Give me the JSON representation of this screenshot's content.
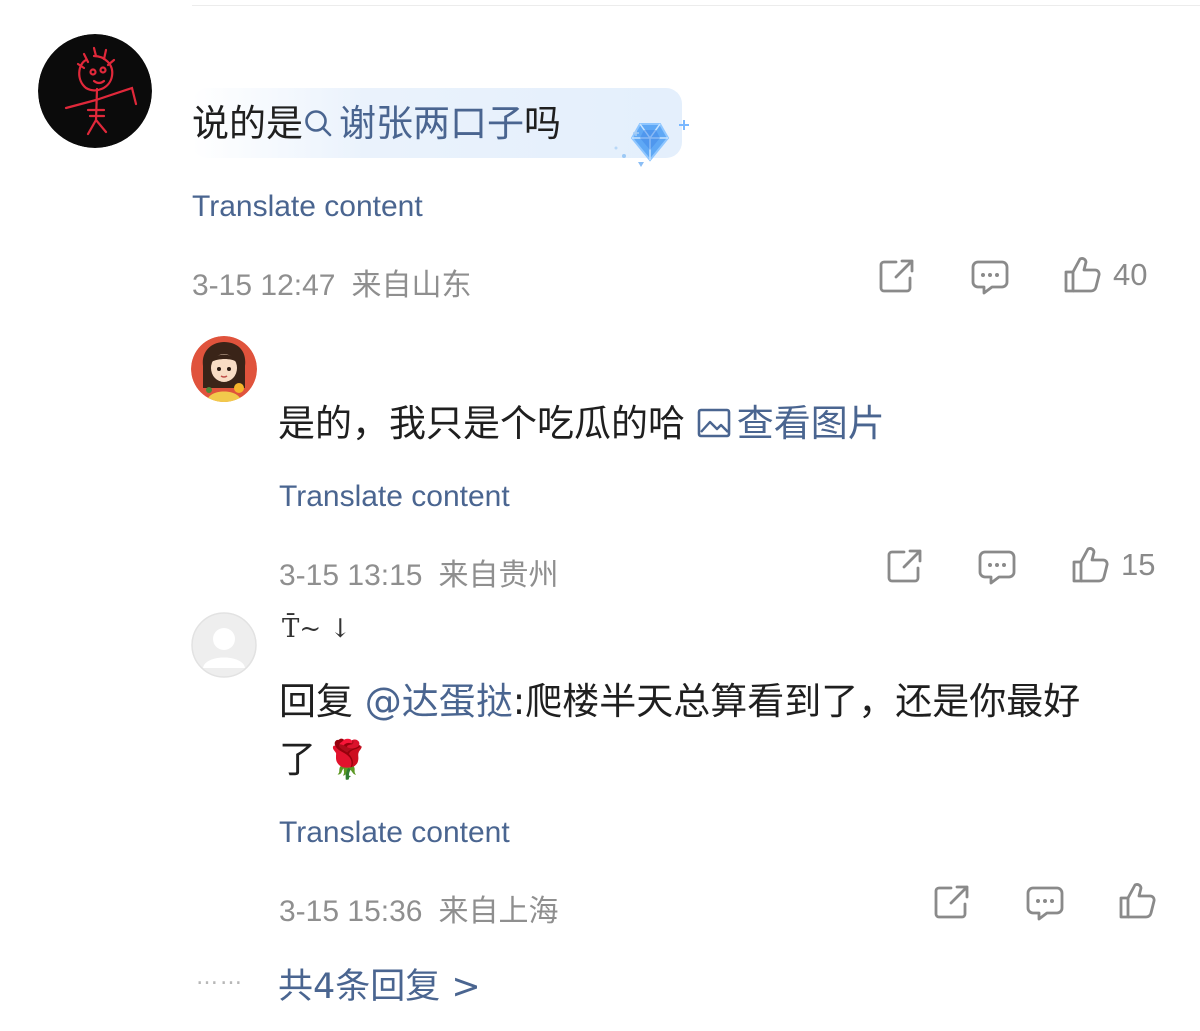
{
  "comments": [
    {
      "text_prefix": "说的是",
      "search_term": "谢张两口子",
      "text_suffix": "吗",
      "translate_label": "Translate content",
      "time": "3-15 12:47",
      "location": "来自山东",
      "like_count": "40"
    },
    {
      "text": "是的，我只是个吃瓜的哈",
      "image_link_label": "查看图片",
      "translate_label": "Translate content",
      "time": "3-15 13:15",
      "location": "来自贵州",
      "like_count": "15"
    },
    {
      "username": "T̄~ ↓",
      "reply_prefix": "回复",
      "mention": "@达蛋挞",
      "reply_text_line1": ":爬楼半天总算看到了，还是你最好",
      "reply_text_line2": "了",
      "emoji": "🌹",
      "translate_label": "Translate content",
      "time": "3-15 15:36",
      "location": "来自上海"
    }
  ],
  "replies_link_label": "共4条回复 >",
  "replies_dots": "……",
  "colors": {
    "link": "#4a6590",
    "meta": "#8f8f8f",
    "icon": "#8a8a8a",
    "text": "#1f1f1f"
  },
  "icons": [
    "share-icon",
    "comment-icon",
    "like-icon",
    "search-icon",
    "image-icon",
    "diamond-icon"
  ]
}
